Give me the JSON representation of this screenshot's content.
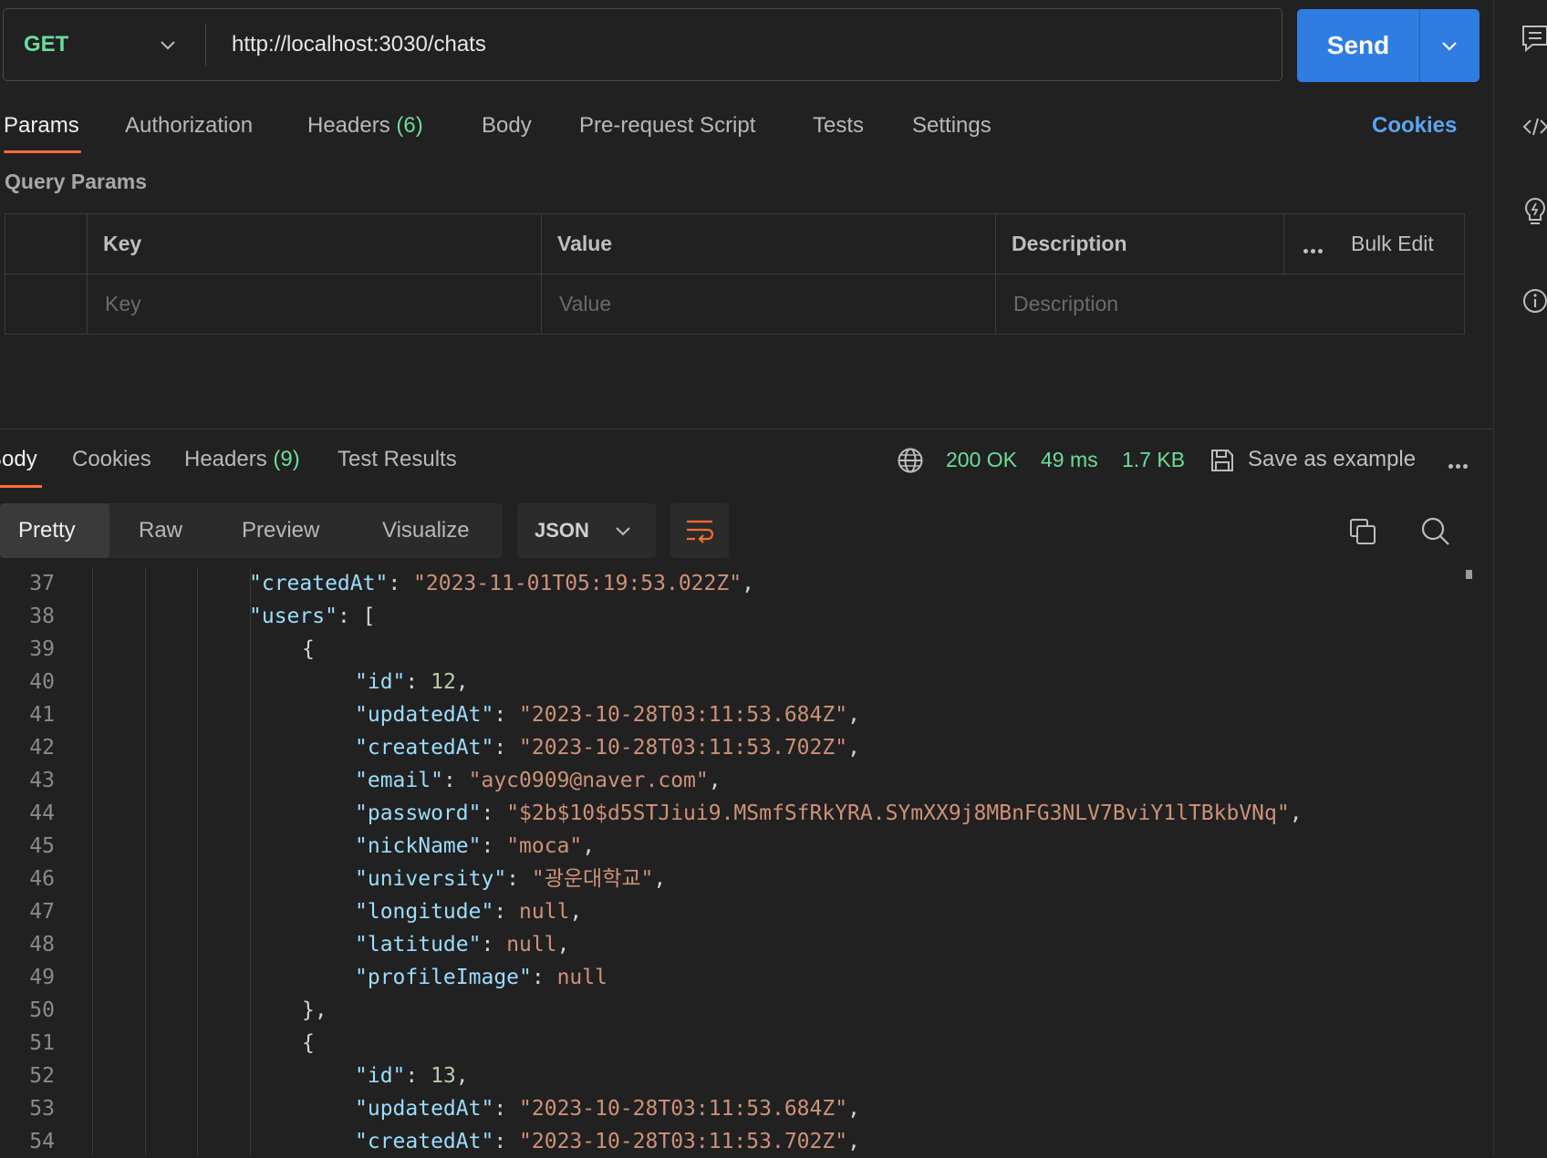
{
  "request": {
    "method": "GET",
    "url": "http://localhost:3030/chats",
    "send_label": "Send"
  },
  "request_tabs": {
    "params": "Params",
    "authorization": "Authorization",
    "headers": "Headers",
    "headers_count": "(6)",
    "body": "Body",
    "prerequest": "Pre-request Script",
    "tests": "Tests",
    "settings": "Settings",
    "cookies": "Cookies"
  },
  "query_params": {
    "title": "Query Params",
    "columns": {
      "key": "Key",
      "value": "Value",
      "description": "Description"
    },
    "bulk_edit": "Bulk Edit",
    "placeholders": {
      "key": "Key",
      "value": "Value",
      "description": "Description"
    }
  },
  "response_tabs": {
    "body": "Body",
    "cookies": "Cookies",
    "headers": "Headers",
    "headers_count": "(9)",
    "test_results": "Test Results"
  },
  "response_status": {
    "status": "200 OK",
    "time": "49 ms",
    "size": "1.7 KB",
    "save_example": "Save as example"
  },
  "view_modes": {
    "pretty": "Pretty",
    "raw": "Raw",
    "preview": "Preview",
    "visualize": "Visualize",
    "format": "JSON"
  },
  "code_lines": [
    {
      "n": "37",
      "k": "\"createdAt\"",
      "v": "\"2023-11-01T05:19:53.022Z\"",
      "t": "s",
      "c": ","
    },
    {
      "n": "38",
      "k": "\"users\"",
      "v": "[",
      "t": "p",
      "c": ""
    },
    {
      "n": "39",
      "k": "",
      "v": "{",
      "t": "p",
      "c": ""
    },
    {
      "n": "40",
      "k": "\"id\"",
      "v": "12",
      "t": "n",
      "c": ","
    },
    {
      "n": "41",
      "k": "\"updatedAt\"",
      "v": "\"2023-10-28T03:11:53.684Z\"",
      "t": "s",
      "c": ","
    },
    {
      "n": "42",
      "k": "\"createdAt\"",
      "v": "\"2023-10-28T03:11:53.702Z\"",
      "t": "s",
      "c": ","
    },
    {
      "n": "43",
      "k": "\"email\"",
      "v": "\"ayc0909@naver.com\"",
      "t": "s",
      "c": ","
    },
    {
      "n": "44",
      "k": "\"password\"",
      "v": "\"$2b$10$d5STJiui9.MSmfSfRkYRA.SYmXX9j8MBnFG3NLV7BviY1lTBkbVNq\"",
      "t": "s",
      "c": ","
    },
    {
      "n": "45",
      "k": "\"nickName\"",
      "v": "\"moca\"",
      "t": "s",
      "c": ","
    },
    {
      "n": "46",
      "k": "\"university\"",
      "v": "\"광운대학교\"",
      "t": "s",
      "c": ","
    },
    {
      "n": "47",
      "k": "\"longitude\"",
      "v": "null",
      "t": "nl",
      "c": ","
    },
    {
      "n": "48",
      "k": "\"latitude\"",
      "v": "null",
      "t": "nl",
      "c": ","
    },
    {
      "n": "49",
      "k": "\"profileImage\"",
      "v": "null",
      "t": "nl",
      "c": ""
    },
    {
      "n": "50",
      "k": "",
      "v": "},",
      "t": "p",
      "c": ""
    },
    {
      "n": "51",
      "k": "",
      "v": "{",
      "t": "p",
      "c": ""
    },
    {
      "n": "52",
      "k": "\"id\"",
      "v": "13",
      "t": "n",
      "c": ","
    },
    {
      "n": "53",
      "k": "\"updatedAt\"",
      "v": "\"2023-10-28T03:11:53.684Z\"",
      "t": "s",
      "c": ","
    },
    {
      "n": "54",
      "k": "\"createdAt\"",
      "v": "\"2023-10-28T03:11:53.702Z\"",
      "t": "s",
      "c": ","
    }
  ],
  "colors": {
    "method": "#6bdd9a",
    "send": "#2f7de1",
    "accent": "#ff6c37",
    "link": "#5aa5f5",
    "status": "#6bdd9a"
  }
}
